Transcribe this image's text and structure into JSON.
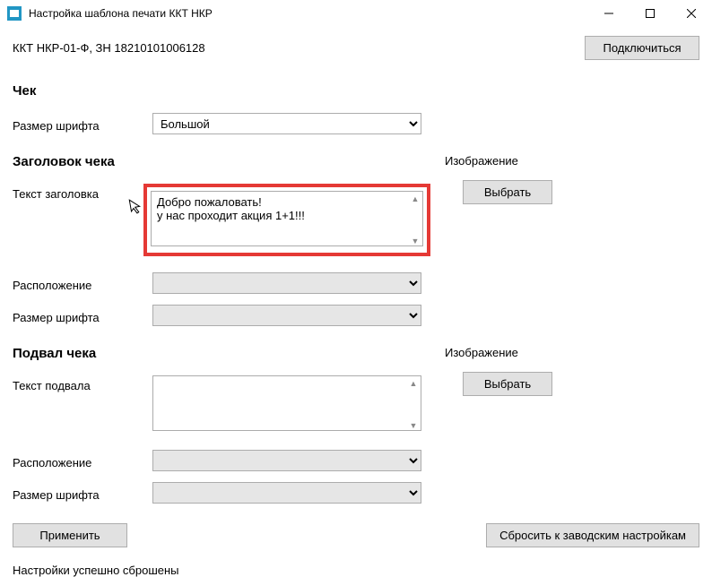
{
  "titlebar": {
    "title": "Настройка шаблона печати ККТ НКР"
  },
  "device_info": "ККТ НКР-01-Ф, ЗН 18210101006128",
  "buttons": {
    "connect": "Подключиться",
    "select": "Выбрать",
    "apply": "Применить",
    "reset": "Сбросить к заводским настройкам"
  },
  "sections": {
    "check": {
      "title": "Чек",
      "font_size_label": "Размер шрифта",
      "font_size_value": "Большой"
    },
    "header": {
      "title": "Заголовок чека",
      "text_label": "Текст заголовка",
      "text_value": "Добро пожаловать!\nу нас проходит акция 1+1!!!",
      "position_label": "Расположение",
      "position_value": "",
      "font_size_label": "Размер шрифта",
      "font_size_value": "",
      "image_label": "Изображение"
    },
    "footer": {
      "title": "Подвал чека",
      "text_label": "Текст подвала",
      "text_value": "",
      "position_label": "Расположение",
      "position_value": "",
      "font_size_label": "Размер шрифта",
      "font_size_value": "",
      "image_label": "Изображение"
    }
  },
  "status": "Настройки успешно сброшены"
}
